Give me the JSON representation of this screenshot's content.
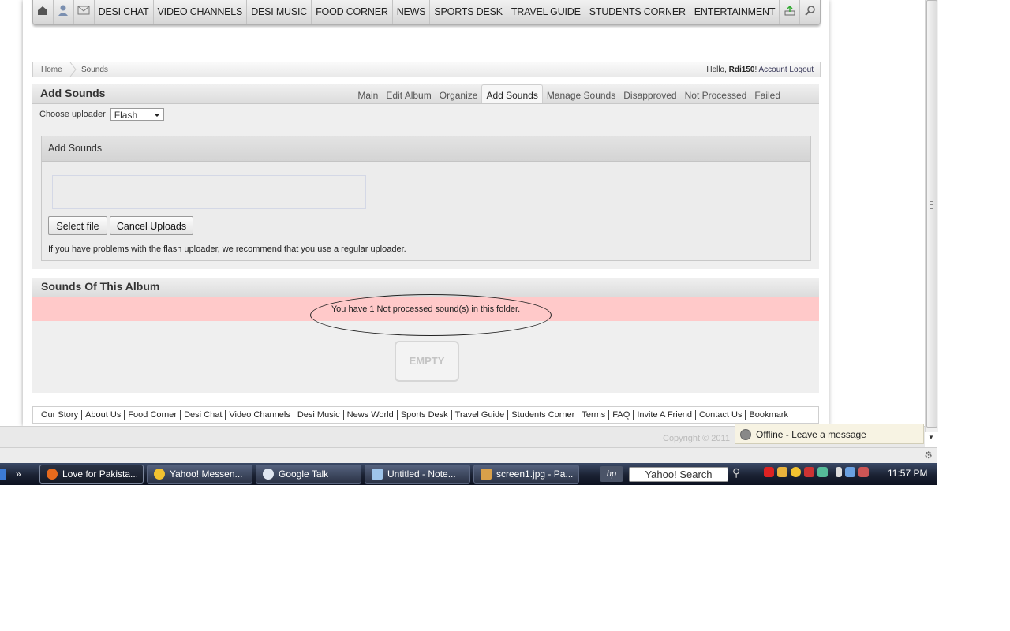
{
  "nav": {
    "items": [
      "DESI CHAT",
      "VIDEO CHANNELS",
      "DESI MUSIC",
      "FOOD CORNER",
      "NEWS",
      "SPORTS DESK",
      "TRAVEL GUIDE",
      "STUDENTS CORNER",
      "ENTERTAINMENT"
    ]
  },
  "breadcrumb": {
    "home": "Home",
    "current": "Sounds",
    "hello_prefix": "Hello, ",
    "username": "Rdi150",
    "exclaim": "! ",
    "account": "Account",
    "logout": "Logout"
  },
  "section": {
    "title": "Add Sounds",
    "tabs": [
      "Main",
      "Edit Album",
      "Organize",
      "Add Sounds",
      "Manage Sounds",
      "Disapproved",
      "Not Processed",
      "Failed"
    ],
    "active_tab": "Add Sounds",
    "uploader_label": "Choose uploader",
    "uploader_value": "Flash"
  },
  "box": {
    "title": "Add Sounds",
    "select_file": "Select file",
    "cancel_uploads": "Cancel Uploads",
    "note": "If you have problems with the flash uploader, we recommend that you use a regular uploader."
  },
  "album": {
    "title": "Sounds Of This Album",
    "notice": "You have 1 Not processed sound(s) in this folder.",
    "empty": "EMPTY"
  },
  "footer": {
    "links": [
      "Our Story",
      "About Us",
      "Food Corner",
      "Desi Chat",
      "Video Channels",
      "Desi Music",
      "News World",
      "Sports Desk",
      "Travel Guide",
      "Students Corner",
      "Terms",
      "FAQ",
      "Invite A Friend",
      "Contact Us",
      "Bookmark"
    ],
    "copyright": "Copyright © 2011"
  },
  "chat": {
    "status": "Offline - Leave a message"
  },
  "taskbar": {
    "windows": [
      "Love for Pakista...",
      "Yahoo! Messen...",
      "Google Talk",
      "Untitled - Note...",
      "screen1.jpg - Pa..."
    ],
    "search": "Yahoo! Search",
    "clock": "11:57 PM"
  },
  "colors": {
    "notice_bg": "#ffc9c9",
    "taskbar": "#1b2233"
  }
}
